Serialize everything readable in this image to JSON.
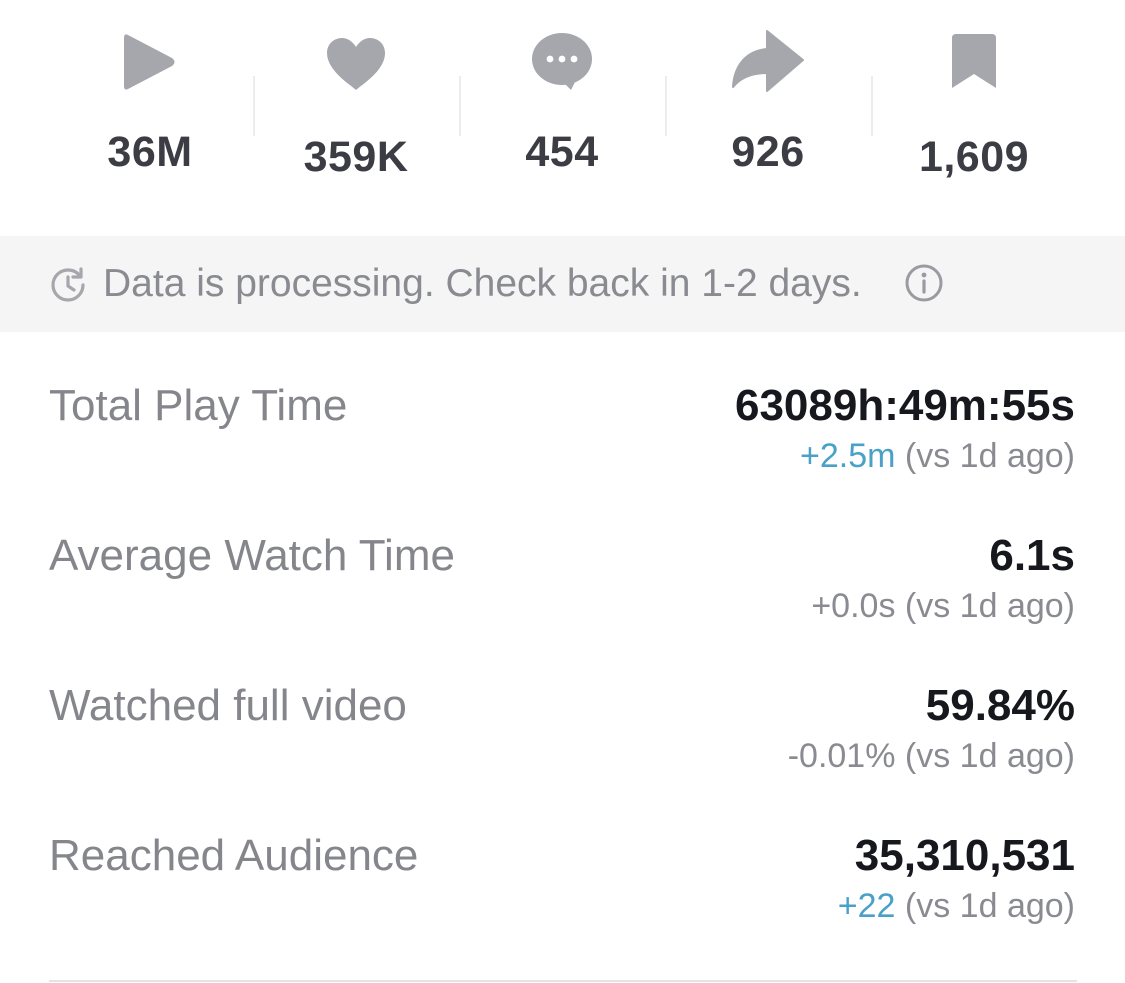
{
  "stats": [
    {
      "icon": "play-icon",
      "value": "36M"
    },
    {
      "icon": "heart-icon",
      "value": "359K"
    },
    {
      "icon": "comment-icon",
      "value": "454"
    },
    {
      "icon": "share-icon",
      "value": "926"
    },
    {
      "icon": "bookmark-icon",
      "value": "1,609"
    }
  ],
  "banner": {
    "icon": "clock-refresh-icon",
    "text": "Data is processing. Check back in 1-2 days.",
    "info_icon": "info-icon"
  },
  "metrics": [
    {
      "label": "Total Play Time",
      "value": "63089h:49m:55s",
      "change": "+2.5m",
      "change_style": "positive",
      "compare": "(vs 1d ago)"
    },
    {
      "label": "Average Watch Time",
      "value": "6.1s",
      "change": "+0.0s",
      "change_style": "neutral",
      "compare": "(vs 1d ago)"
    },
    {
      "label": "Watched full video",
      "value": "59.84%",
      "change": "-0.01%",
      "change_style": "neutral",
      "compare": "(vs 1d ago)"
    },
    {
      "label": "Reached Audience",
      "value": "35,310,531",
      "change": "+22",
      "change_style": "positive",
      "compare": "(vs 1d ago)"
    }
  ],
  "colors": {
    "icon_gray": "#a6a7ad",
    "positive": "#4aa1c8",
    "banner_bg": "#f5f5f5"
  }
}
